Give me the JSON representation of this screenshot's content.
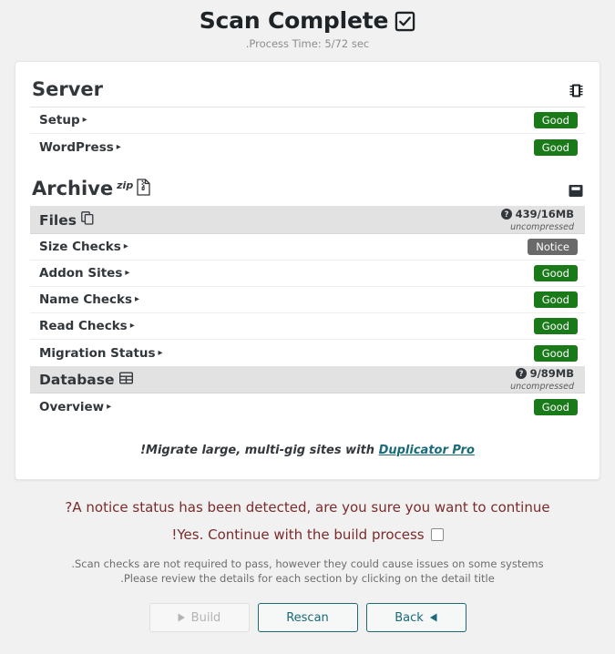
{
  "header": {
    "title": "Scan Complete",
    "title_icon": "checkbox-checked-icon",
    "subtitle": ".Process Time: 5/72 sec"
  },
  "server_section": {
    "title": "Server",
    "icon": "microchip-icon",
    "rows": [
      {
        "label": "Setup",
        "caret": "▸",
        "status": "Good",
        "status_type": "good"
      },
      {
        "label": "WordPress",
        "caret": "▸",
        "status": "Good",
        "status_type": "good"
      }
    ]
  },
  "archive_section": {
    "title": "Archive",
    "superscript": "zip",
    "title_icon": "file-archive-icon",
    "icon": "archive-box-icon",
    "groups": [
      {
        "label": "Files",
        "icon": "copy-files-icon",
        "info_icon": "question-circle-icon",
        "size": "439/16MB",
        "size_note": "uncompressed",
        "rows": [
          {
            "label": "Size Checks",
            "caret": "▸",
            "status": "Notice",
            "status_type": "notice"
          },
          {
            "label": "Addon Sites",
            "caret": "▸",
            "status": "Good",
            "status_type": "good"
          },
          {
            "label": "Name Checks",
            "caret": "▸",
            "status": "Good",
            "status_type": "good"
          },
          {
            "label": "Read Checks",
            "caret": "▸",
            "status": "Good",
            "status_type": "good"
          },
          {
            "label": "Migration Status",
            "caret": "▸",
            "status": "Good",
            "status_type": "good"
          }
        ]
      },
      {
        "label": "Database",
        "icon": "table-grid-icon",
        "info_icon": "question-circle-icon",
        "size": "9/89MB",
        "size_note": "uncompressed",
        "rows": [
          {
            "label": "Overview",
            "caret": "▸",
            "status": "Good",
            "status_type": "good"
          }
        ]
      }
    ]
  },
  "promo": {
    "text": "!Migrate large, multi-gig sites with",
    "link_label": "Duplicator Pro"
  },
  "footer": {
    "warning": "?A notice status has been detected, are you sure you want to continue",
    "confirm_label": "!Yes. Continue with the build process",
    "confirm_checked": false,
    "hint_line_1": ".Scan checks are not required to pass, however they could cause issues on some systems",
    "hint_line_2": ".Please review the details for each section by clicking on the detail title",
    "buttons": {
      "build": "Build",
      "build_icon": "play-triangle-icon",
      "rescan": "Rescan",
      "back": "Back",
      "back_icon": "left-triangle-icon"
    }
  },
  "colors": {
    "good": "#1a7a1a",
    "notice": "#6a6a6a",
    "link": "#1a6a78",
    "warning_text": "#7a2b2b",
    "page_bg": "#f1f1f1"
  }
}
